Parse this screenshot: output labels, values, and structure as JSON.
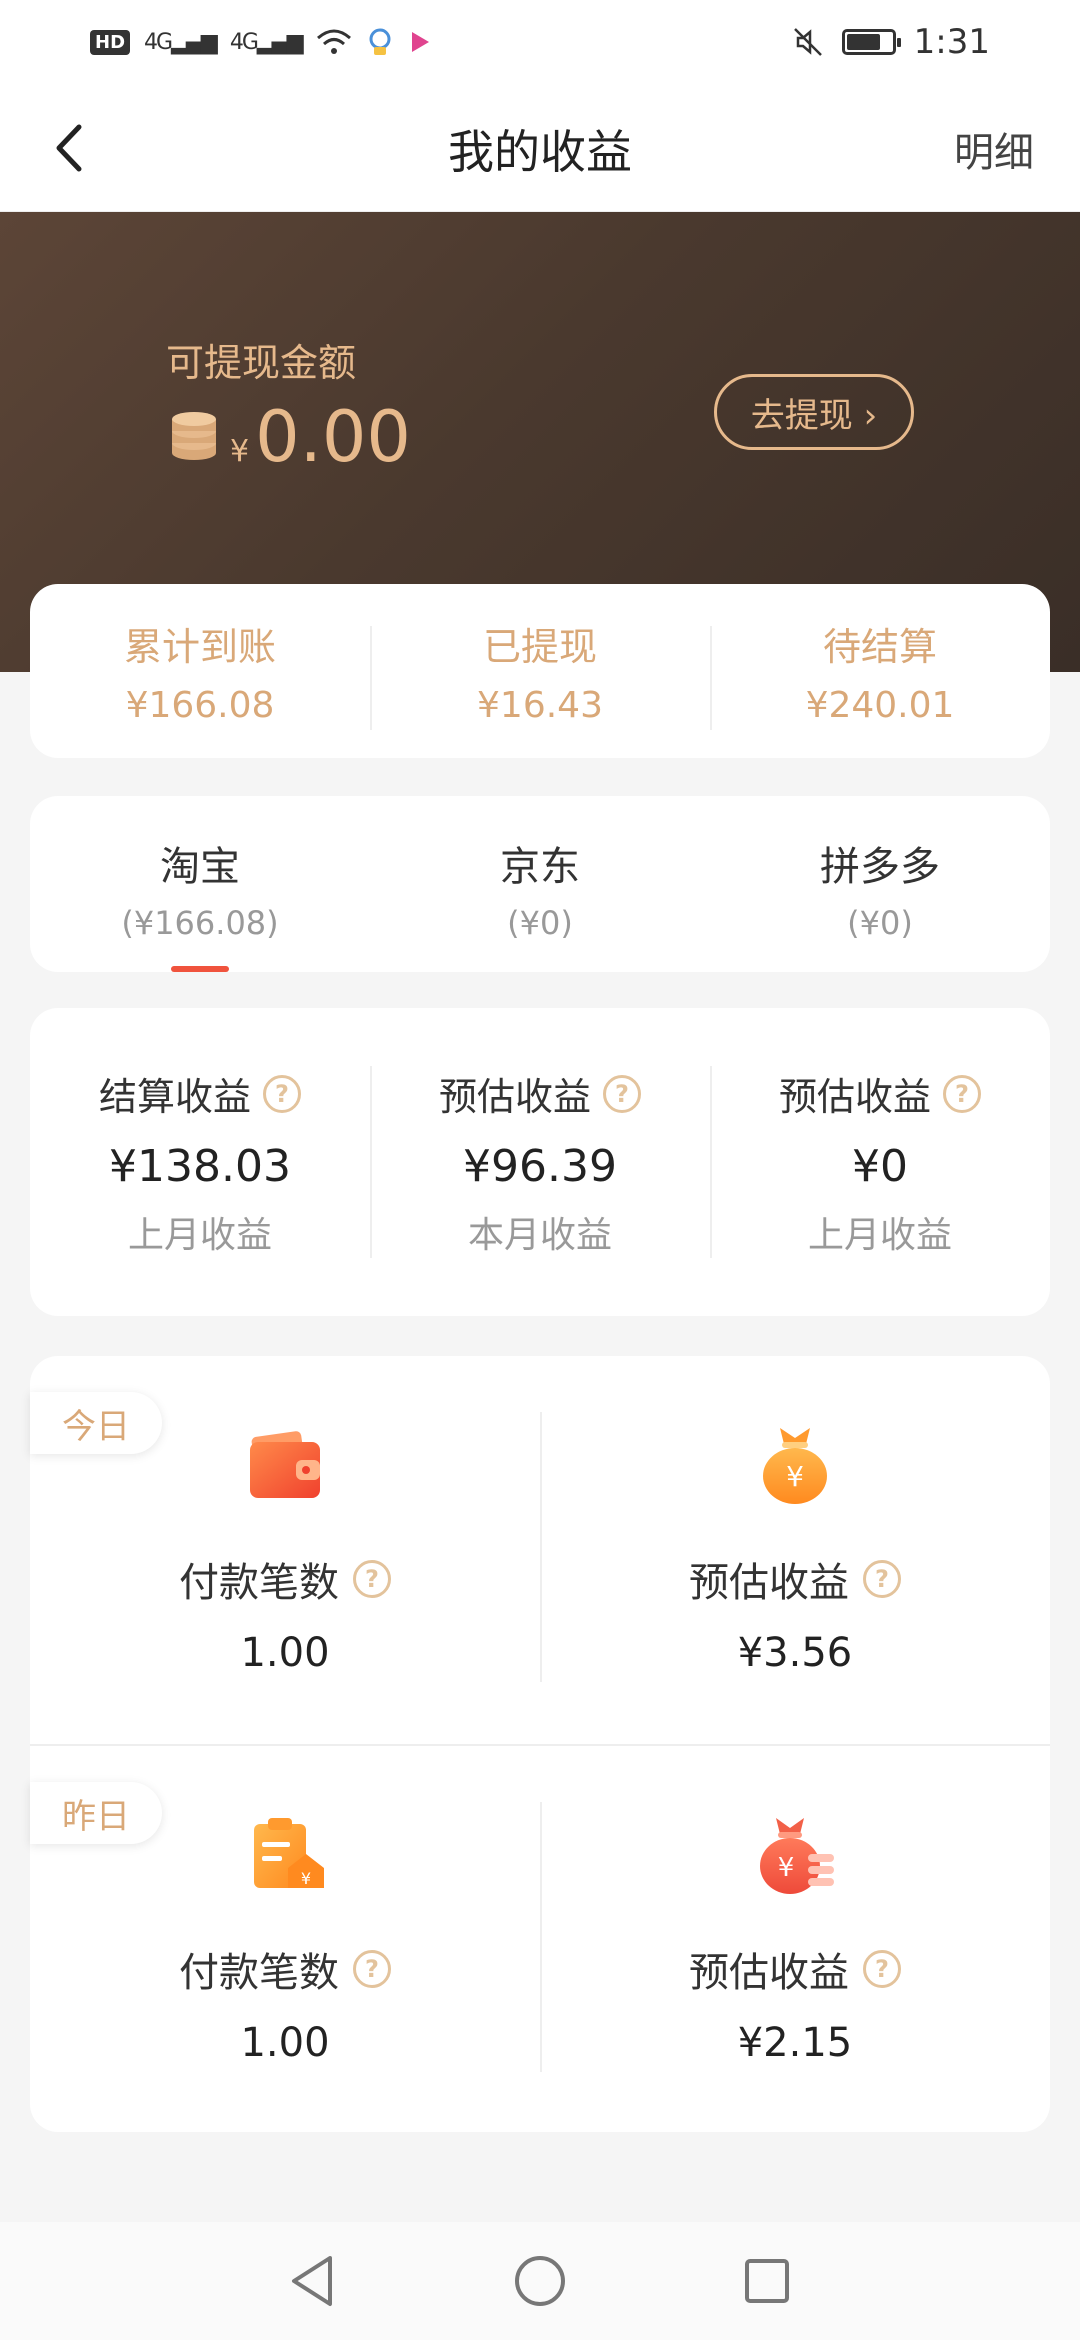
{
  "status_bar": {
    "hd": "HD",
    "signal1": "4G",
    "signal2": "4G",
    "time": "1:31"
  },
  "header": {
    "title": "我的收益",
    "detail": "明细"
  },
  "balance": {
    "label": "可提现金额",
    "currency": "¥",
    "amount": "0.00",
    "withdraw_button": "去提现 ›"
  },
  "summary": [
    {
      "label": "累计到账",
      "value": "¥166.08"
    },
    {
      "label": "已提现",
      "value": "¥16.43"
    },
    {
      "label": "待结算",
      "value": "¥240.01"
    }
  ],
  "platform_tabs": [
    {
      "name": "淘宝",
      "value": "(¥166.08)",
      "active": true
    },
    {
      "name": "京东",
      "value": "(¥0)",
      "active": false
    },
    {
      "name": "拼多多",
      "value": "(¥0)",
      "active": false
    }
  ],
  "monthly": [
    {
      "label": "结算收益",
      "value": "¥138.03",
      "sub": "上月收益"
    },
    {
      "label": "预估收益",
      "value": "¥96.39",
      "sub": "本月收益"
    },
    {
      "label": "预估收益",
      "value": "¥0",
      "sub": "上月收益"
    }
  ],
  "daily": {
    "today": {
      "tag": "今日",
      "items": [
        {
          "label": "付款笔数",
          "value": "1.00",
          "icon": "wallet-icon"
        },
        {
          "label": "预估收益",
          "value": "¥3.56",
          "icon": "money-bag-icon"
        }
      ]
    },
    "yesterday": {
      "tag": "昨日",
      "items": [
        {
          "label": "付款笔数",
          "value": "1.00",
          "icon": "order-receipt-icon"
        },
        {
          "label": "预估收益",
          "value": "¥2.15",
          "icon": "money-bag-coins-icon"
        }
      ]
    }
  },
  "colors": {
    "gold": "#d9a878",
    "hero_gold": "#e6b98c",
    "hero_bg": "#4a392e",
    "active_tab": "#f0533d",
    "icon_orange": "#ff7a2e"
  }
}
